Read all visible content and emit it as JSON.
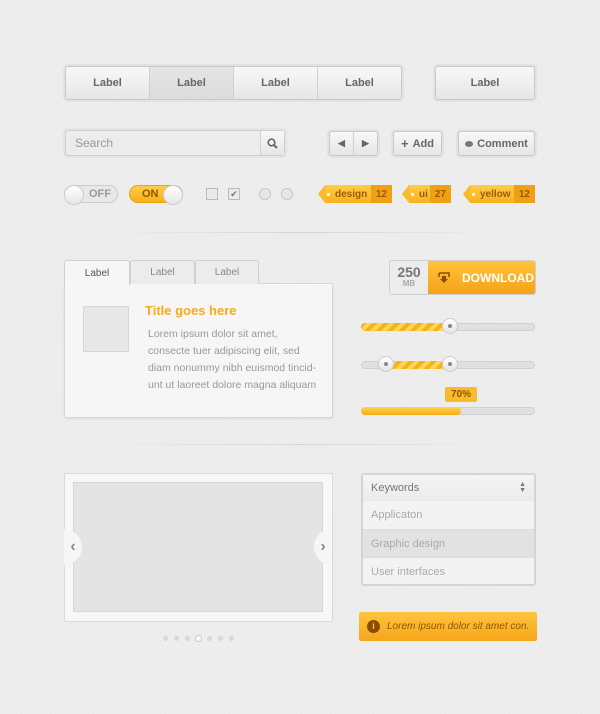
{
  "segmented": {
    "items": [
      "Label",
      "Label",
      "Label",
      "Label"
    ],
    "active_index": 1
  },
  "single_button": "Label",
  "search": {
    "placeholder": "Search",
    "value": ""
  },
  "pager": {
    "prev": "◀",
    "next": "▶"
  },
  "add_button": "Add",
  "comment_button": "Comment",
  "toggles": {
    "off": "OFF",
    "on": "ON"
  },
  "checkboxes": [
    {
      "checked": false
    },
    {
      "checked": true
    }
  ],
  "radios": [
    {
      "checked": false
    },
    {
      "checked": false
    }
  ],
  "tags": [
    {
      "label": "design",
      "count": "12"
    },
    {
      "label": "ui",
      "count": "27"
    },
    {
      "label": "yellow",
      "count": "12"
    }
  ],
  "tabs": {
    "items": [
      "Label",
      "Label",
      "Label"
    ],
    "active_index": 0,
    "title": "Title goes here",
    "body": [
      "Lorem ipsum dolor sit amet,",
      "consecte tuer adipiscing elit, sed",
      "diam nonummy nibh euismod tincid-",
      "unt ut laoreet dolore magna aliquam"
    ]
  },
  "download": {
    "size": "250",
    "unit": "MB",
    "label": "DOWNLOAD"
  },
  "slider_single": {
    "value_percent": 51
  },
  "slider_range": {
    "low_percent": 14,
    "high_percent": 51
  },
  "progress": {
    "value_percent": 70,
    "label": "70%"
  },
  "carousel": {
    "pages": 7,
    "active_page": 4
  },
  "select": {
    "label": "Keywords",
    "options": [
      "Applicaton",
      "Graphic design",
      "User interfaces"
    ],
    "highlighted_index": 1
  },
  "alert": {
    "text": "Lorem ipsum dolor sit amet con."
  },
  "colors": {
    "accent": "#f7b21f",
    "background": "#eeeeee"
  }
}
